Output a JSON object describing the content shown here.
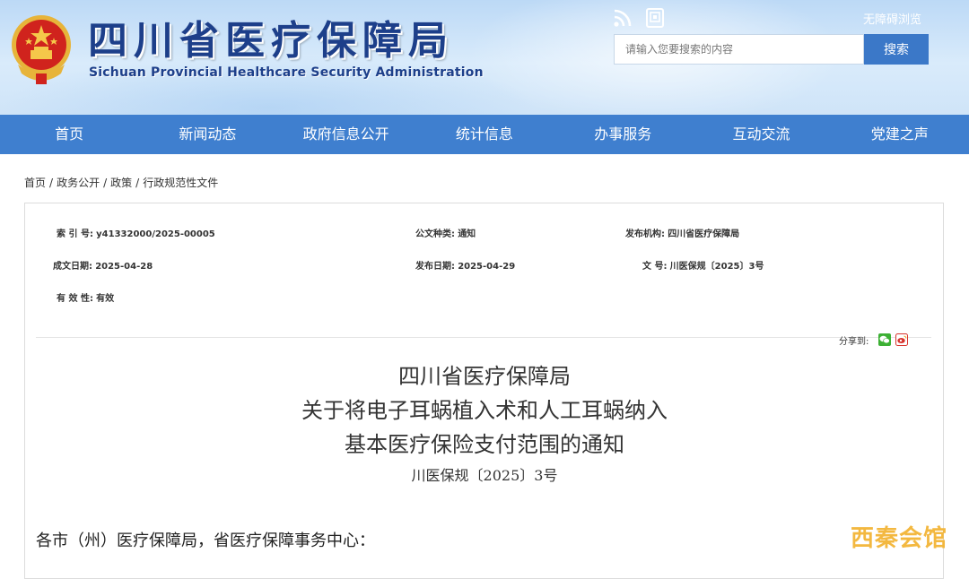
{
  "header": {
    "site_title": "四川省医疗保障局",
    "site_subtitle": "Sichuan Provincial Healthcare Security Administration",
    "accessibility_label": "无障碍浏览",
    "search_placeholder": "请输入您要搜索的内容",
    "search_button": "搜索",
    "icons": [
      "national-emblem-icon",
      "rss-icon",
      "mobile-icon"
    ]
  },
  "nav": {
    "items": [
      "首页",
      "新闻动态",
      "政府信息公开",
      "统计信息",
      "办事服务",
      "互动交流",
      "党建之声"
    ]
  },
  "breadcrumb": {
    "items": [
      "首页",
      "政务公开",
      "政策",
      "行政规范性文件"
    ],
    "separator": "/"
  },
  "meta": {
    "index_label": "索 引 号:",
    "index_value": "y41332000/2025-00005",
    "doc_type_label": "公文种类:",
    "doc_type_value": "通知",
    "publisher_label": "发布机构:",
    "publisher_value": "四川省医疗保障局",
    "created_label": "成文日期:",
    "created_value": "2025-04-28",
    "published_label": "发布日期:",
    "published_value": "2025-04-29",
    "docno_label": "文 号:",
    "docno_value": "川医保规〔2025〕3号",
    "validity_label": "有 效 性:",
    "validity_value": "有效"
  },
  "share": {
    "label": "分享到:",
    "icons": [
      "wechat-icon",
      "weibo-icon"
    ]
  },
  "document": {
    "title_line1": "四川省医疗保障局",
    "title_line2": "关于将电子耳蜗植入术和人工耳蜗纳入",
    "title_line3": "基本医疗保险支付范围的通知",
    "doc_number": "川医保规〔2025〕3号",
    "salutation": "各市（州）医疗保障局，省医疗保障事务中心："
  },
  "watermark": "西秦会馆",
  "colors": {
    "nav_bg": "#3f7fcf",
    "search_button_bg": "#3b78c8",
    "title_text": "#1d3f8a",
    "watermark": "#f3b536"
  }
}
